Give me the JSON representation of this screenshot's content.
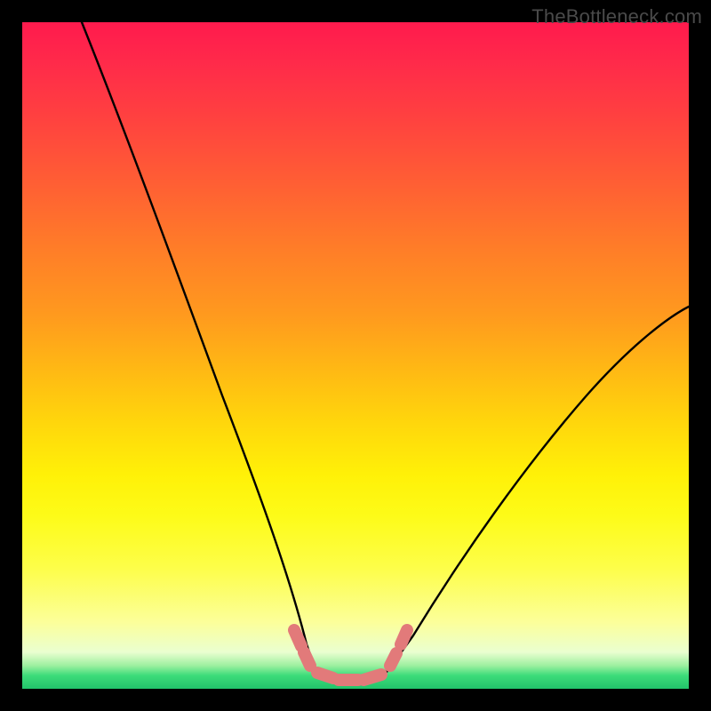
{
  "watermark": "TheBottleneck.com",
  "chart_data": {
    "type": "line",
    "title": "",
    "xlabel": "",
    "ylabel": "",
    "xlim": [
      0,
      100
    ],
    "ylim": [
      0,
      100
    ],
    "grid": false,
    "legend": false,
    "background_gradient": {
      "direction": "vertical",
      "stops": [
        {
          "pct": 0,
          "color": "#ff1a4d"
        },
        {
          "pct": 35,
          "color": "#ff7d28"
        },
        {
          "pct": 68,
          "color": "#fff108"
        },
        {
          "pct": 92,
          "color": "#fcff9a"
        },
        {
          "pct": 100,
          "color": "#22c36b"
        }
      ]
    },
    "series": [
      {
        "name": "left-curve",
        "color": "#000000",
        "x": [
          9,
          12,
          16,
          20,
          24,
          28,
          32,
          35,
          38,
          41,
          43.5
        ],
        "y": [
          100,
          89,
          77,
          65,
          53,
          41,
          29,
          20,
          12,
          6,
          2.5
        ]
      },
      {
        "name": "right-curve",
        "color": "#000000",
        "x": [
          55,
          58,
          62,
          67,
          72,
          78,
          84,
          90,
          96,
          100
        ],
        "y": [
          2.5,
          6,
          12,
          19,
          26,
          33,
          40,
          47,
          53,
          57
        ]
      },
      {
        "name": "valley-floor",
        "color": "#000000",
        "x": [
          43.5,
          46,
          49,
          52,
          55
        ],
        "y": [
          2.5,
          1.5,
          1.3,
          1.5,
          2.5
        ]
      },
      {
        "name": "marker-band",
        "color": "#e37b7b",
        "type": "scatter",
        "x": [
          41.5,
          42.5,
          43.5,
          45,
          47,
          49,
          51,
          53,
          55,
          56,
          57
        ],
        "y": [
          5.0,
          3.5,
          2.5,
          1.8,
          1.5,
          1.3,
          1.5,
          1.8,
          2.5,
          4.0,
          5.5
        ]
      }
    ]
  }
}
